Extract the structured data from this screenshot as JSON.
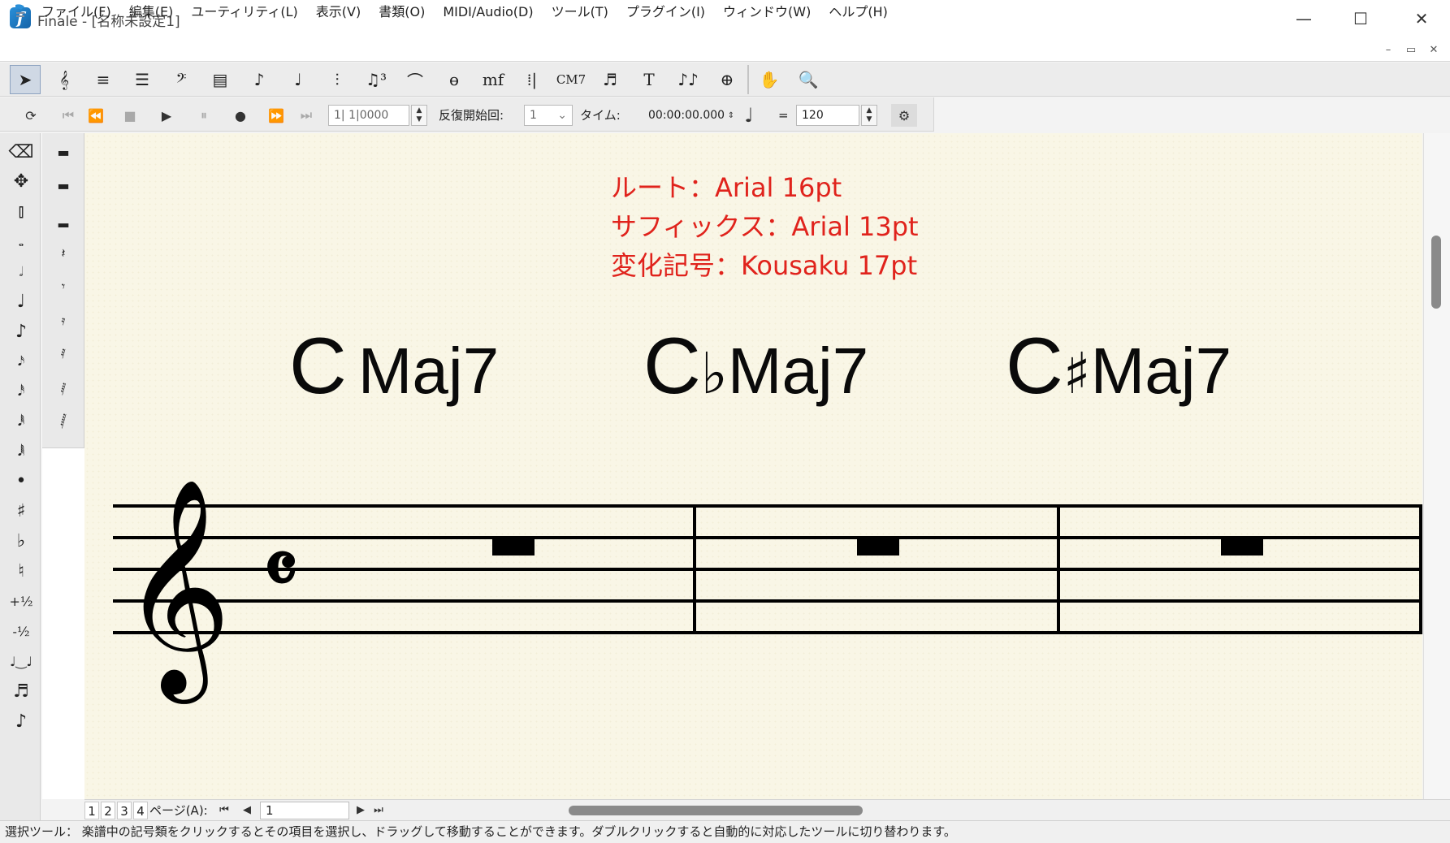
{
  "window": {
    "title": "Finale - [名称未設定1]",
    "logo_letter": "f",
    "minimize": "—",
    "maximize": "☐",
    "close": "✕"
  },
  "menu": {
    "items": [
      {
        "label": "ファイル(F)"
      },
      {
        "label": "編集(E)"
      },
      {
        "label": "ユーティリティ(L)"
      },
      {
        "label": "表示(V)"
      },
      {
        "label": "書類(O)"
      },
      {
        "label": "MIDI/Audio(D)"
      },
      {
        "label": "ツール(T)"
      },
      {
        "label": "プラグイン(I)"
      },
      {
        "label": "ウィンドウ(W)"
      },
      {
        "label": "ヘルプ(H)"
      }
    ],
    "mdi_min": "–",
    "mdi_restore": "▭",
    "mdi_close": "✕"
  },
  "toolbar": {
    "tools": [
      {
        "name": "selection-tool",
        "glyph": "➤",
        "selected": true
      },
      {
        "name": "staff-tool",
        "glyph": "𝄞"
      },
      {
        "name": "simple-entry-tool",
        "glyph": "≡"
      },
      {
        "name": "speedy-entry-tool",
        "glyph": "☰"
      },
      {
        "name": "clef-tool",
        "glyph": "𝄢"
      },
      {
        "name": "measure-tool",
        "glyph": "▤"
      },
      {
        "name": "note-tool",
        "glyph": "♪"
      },
      {
        "name": "playback-note-tool",
        "glyph": "♩"
      },
      {
        "name": "articulation-tool",
        "glyph": "⫶"
      },
      {
        "name": "tuplet-tool",
        "glyph": "♫³"
      },
      {
        "name": "slur-tool",
        "glyph": "⌒"
      },
      {
        "name": "ornament-tool",
        "glyph": "ɵ"
      },
      {
        "name": "expression-tool",
        "glyph": "mf"
      },
      {
        "name": "repeat-tool",
        "glyph": "⁞|"
      },
      {
        "name": "chord-tool",
        "glyph": "CM7"
      },
      {
        "name": "lyrics-tool",
        "glyph": "♬"
      },
      {
        "name": "text-tool",
        "glyph": "T"
      },
      {
        "name": "smart-shape-tool",
        "glyph": "♪♪"
      },
      {
        "name": "page-layout-tool",
        "glyph": "⊕"
      },
      {
        "name": "hand-grabber-tool",
        "glyph": "✋"
      },
      {
        "name": "zoom-tool",
        "glyph": "🔍"
      }
    ]
  },
  "playback": {
    "loop": "⟳",
    "rewind_start": "⏮",
    "rewind": "⏪",
    "stop": "■",
    "play": "▶",
    "pause": "⏸",
    "record": "●",
    "forward": "⏩",
    "forward_end": "⏭",
    "position_value": "1| 1|0000",
    "repeat_label": "反復開始回:",
    "repeat_value": "1",
    "time_label": "タイム:",
    "time_value": "00:00:00.000",
    "beat_note": "♩",
    "equals": "=",
    "tempo_value": "120",
    "settings": "⚙"
  },
  "palette_left": [
    {
      "name": "eraser-icon",
      "glyph": "⌫"
    },
    {
      "name": "move-icon",
      "glyph": "✥"
    },
    {
      "name": "measure-rest-icon",
      "glyph": "⫾"
    },
    {
      "name": "whole-note-icon",
      "glyph": "𝅝"
    },
    {
      "name": "half-note-icon",
      "glyph": "𝅗𝅥"
    },
    {
      "name": "quarter-note-icon",
      "glyph": "♩"
    },
    {
      "name": "eighth-note-icon",
      "glyph": "♪"
    },
    {
      "name": "sixteenth-note-icon",
      "glyph": "𝅘𝅥𝅯"
    },
    {
      "name": "thirty-second-note-icon",
      "glyph": "𝅘𝅥𝅰"
    },
    {
      "name": "sixty-fourth-note-icon",
      "glyph": "𝅘𝅥𝅱"
    },
    {
      "name": "hundred-twenty-eighth-note-icon",
      "glyph": "𝅘𝅥𝅲"
    },
    {
      "name": "dot-icon",
      "glyph": "•"
    },
    {
      "name": "sharp-icon",
      "glyph": "♯"
    },
    {
      "name": "flat-icon",
      "glyph": "♭"
    },
    {
      "name": "natural-icon",
      "glyph": "♮"
    },
    {
      "name": "raise-half-step-icon",
      "glyph": "+½"
    },
    {
      "name": "lower-half-step-icon",
      "glyph": "-½"
    },
    {
      "name": "tie-icon",
      "glyph": "♩‿♩"
    },
    {
      "name": "grace-note-icon",
      "glyph": "♬"
    },
    {
      "name": "slash-grace-icon",
      "glyph": "♪"
    }
  ],
  "palette_right": [
    {
      "name": "whole-rest-icon",
      "glyph": "▬"
    },
    {
      "name": "half-rest-icon",
      "glyph": "▬"
    },
    {
      "name": "half-rest-alt-icon",
      "glyph": "▂"
    },
    {
      "name": "quarter-rest-icon",
      "glyph": "𝄽"
    },
    {
      "name": "eighth-rest-icon",
      "glyph": "𝄾"
    },
    {
      "name": "sixteenth-rest-icon",
      "glyph": "𝄿"
    },
    {
      "name": "thirty-second-rest-icon",
      "glyph": "𝅀"
    },
    {
      "name": "sixty-fourth-rest-icon",
      "glyph": "𝅁"
    },
    {
      "name": "hundred-twenty-eighth-rest-icon",
      "glyph": "𝅂"
    }
  ],
  "score": {
    "info_lines": [
      "ルート：Arial 16pt",
      "サフィックス：Arial 13pt",
      "変化記号：Kousaku 17pt"
    ],
    "chords": [
      {
        "root": "C",
        "accidental": "",
        "suffix": "Maj7"
      },
      {
        "root": "C",
        "accidental": "♭",
        "suffix": "Maj7"
      },
      {
        "root": "C",
        "accidental": "♯",
        "suffix": "Maj7"
      }
    ],
    "clef": "treble",
    "time_signature": "C",
    "measures": 3
  },
  "pagebar": {
    "tabs": [
      "1",
      "2",
      "3",
      "4"
    ],
    "page_label": "ページ(A):",
    "first": "⏮",
    "prev": "◀",
    "page_value": "1",
    "next": "▶",
    "last": "⏭"
  },
  "status": {
    "text": "選択ツール： 楽譜中の記号類をクリックするとその項目を選択し、ドラッグして移動することができます。ダブルクリックすると自動的に対応したツールに切り替わります。"
  },
  "colors": {
    "annotation_red": "#e0231c",
    "canvas": "#f9f6e6",
    "selected_tool": "#cfd8e4"
  }
}
